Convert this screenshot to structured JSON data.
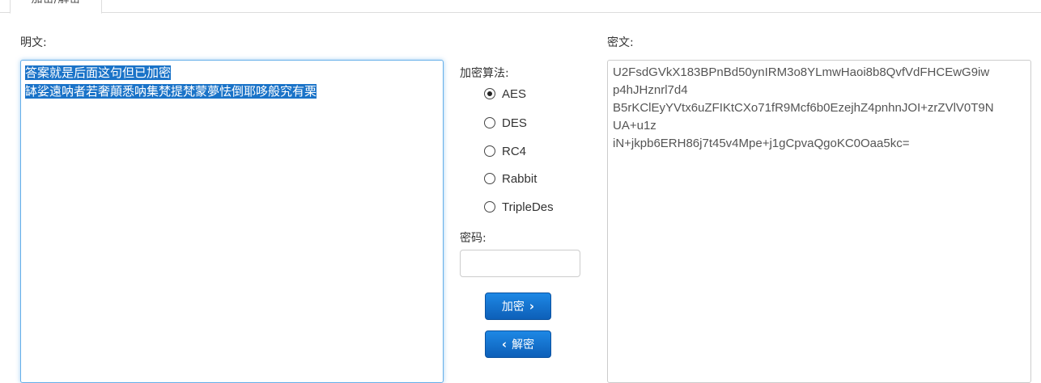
{
  "tabs": [
    "加密/解密",
    "",
    "",
    ""
  ],
  "plaintext": {
    "label": "明文:",
    "lines": [
      "答案就是后面这句但已加密",
      "缽娑遠呐者若奢顛悉呐集梵提梵蒙夢怯倒耶哆般究有栗"
    ]
  },
  "cipher": {
    "label": "密文:",
    "lines": [
      "U2FsdGVkX183BPnBd50ynIRM3o8YLmwHaoi8b8QvfVdFHCEwG9iw",
      "p4hJHznrl7d4",
      "B5rKClEyYVtx6uZFIKtCXo71fR9Mcf6b0EzejhZ4pnhnJOI+zrZVlV0T9N",
      "UA+u1z",
      "iN+jkpb6ERH86j7t45v4Mpe+j1gCpvaQgoKC0Oaa5kc="
    ]
  },
  "algorithm": {
    "label": "加密算法:",
    "options": [
      "AES",
      "DES",
      "RC4",
      "Rabbit",
      "TripleDes"
    ],
    "selected": "AES"
  },
  "password": {
    "label": "密码:",
    "value": ""
  },
  "buttons": {
    "encrypt": "加密",
    "decrypt": "解密"
  }
}
